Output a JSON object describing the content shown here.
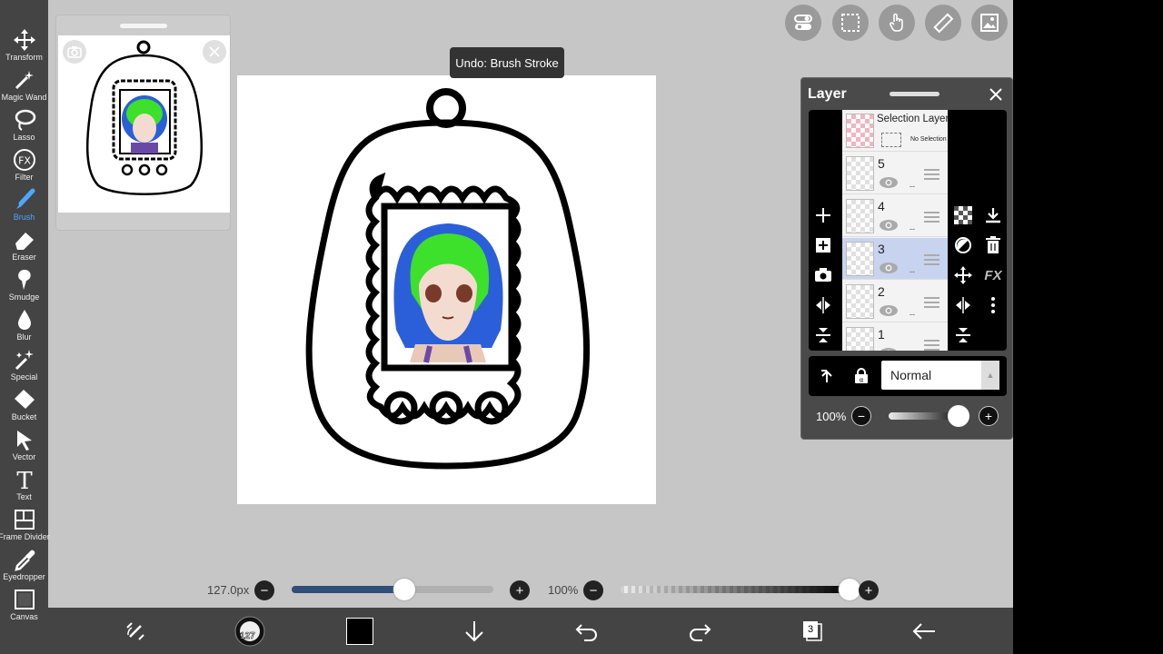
{
  "toolbar": {
    "tools": [
      {
        "label": "Transform",
        "icon": "move-arrows-icon"
      },
      {
        "label": "Magic Wand",
        "icon": "magic-wand-icon"
      },
      {
        "label": "Lasso",
        "icon": "lasso-icon"
      },
      {
        "label": "Filter",
        "icon": "fx-icon",
        "glyph": "FX"
      },
      {
        "label": "Brush",
        "icon": "brush-icon",
        "active": true
      },
      {
        "label": "Eraser",
        "icon": "eraser-icon"
      },
      {
        "label": "Smudge",
        "icon": "smudge-icon"
      },
      {
        "label": "Blur",
        "icon": "blur-drop-icon"
      },
      {
        "label": "Special",
        "icon": "special-wand-icon"
      },
      {
        "label": "Bucket",
        "icon": "bucket-icon"
      },
      {
        "label": "Vector",
        "icon": "vector-arrow-icon"
      },
      {
        "label": "Text",
        "icon": "text-icon",
        "glyph": "T"
      },
      {
        "label": "Frame Divider",
        "icon": "frame-divider-icon"
      },
      {
        "label": "Eyedropper",
        "icon": "eyedropper-icon"
      },
      {
        "label": "Canvas",
        "icon": "canvas-icon"
      }
    ],
    "active_color": "#4aa8ff"
  },
  "tooltip": {
    "text": "Undo: Brush Stroke"
  },
  "layer_panel": {
    "title": "Layer",
    "selection_layer": {
      "name": "Selection Layer",
      "status": "No Selection"
    },
    "layers": [
      {
        "number": "5",
        "dash": "--"
      },
      {
        "number": "4",
        "dash": "--"
      },
      {
        "number": "3",
        "dash": "--",
        "selected": true
      },
      {
        "number": "2",
        "dash": "--"
      },
      {
        "number": "1",
        "dash": ""
      }
    ],
    "blend_mode": "Normal",
    "opacity": "100%",
    "side_right_fx": "FX"
  },
  "brush_size": {
    "label": "127.0px",
    "value_fraction": 0.56
  },
  "brush_opacity": {
    "label": "100%",
    "value_fraction": 1.0
  },
  "bottom_bar": {
    "brush_badge": "127",
    "layer_count": "3",
    "color": "#000000"
  },
  "colors": {
    "hair_blue": "#2b5fd9",
    "hair_green": "#3de02a",
    "skin": "#f3dccf",
    "panel_bg": "#4a4a4a",
    "app_bg": "#c6c6c6"
  }
}
